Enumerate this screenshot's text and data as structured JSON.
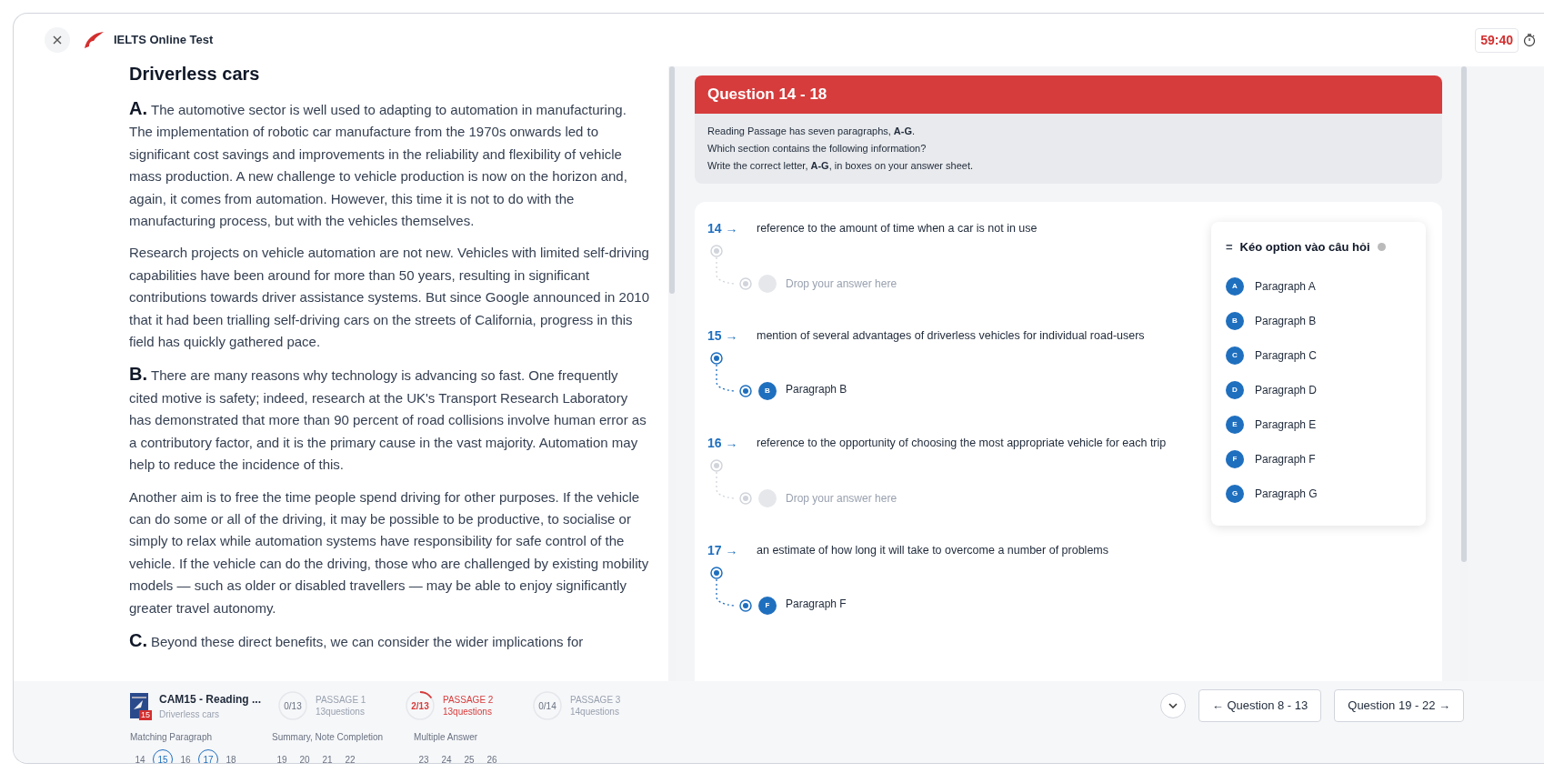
{
  "top_bar": {
    "title": "IELTS Online Test",
    "timer": "59:40"
  },
  "passage": {
    "title": "Driverless cars",
    "paragraphs": [
      {
        "letter": "A.",
        "text": "The automotive sector is well used to adapting to automation in manufacturing. The implementation of robotic car manufacture from the 1970s onwards led to significant cost savings and improvements in the reliability and flexibility of vehicle mass production. A new challenge to vehicle production is now on the horizon and, again, it comes from automation. However, this time it is not to do with the manufacturing process, but with the vehicles themselves."
      },
      {
        "text": "Research projects on vehicle automation are not new. Vehicles with limited self-driving capabilities have been around for more than 50 years, resulting in significant contributions towards driver assistance systems. But since Google announced in 2010 that it had been trialling self-driving cars on the streets of California, progress in this field has quickly gathered pace."
      },
      {
        "letter": "B.",
        "text": "There are many reasons why technology is advancing so fast. One frequently cited motive is safety; indeed, research at the UK's Transport Research Laboratory has demonstrated that more than 90 percent of road collisions involve human error as a contributory factor, and it is the primary cause in the vast majority. Automation may help to reduce the incidence of this."
      },
      {
        "text": "Another aim is to free the time people spend driving for other purposes. If the vehicle can do some or all of the driving, it may be possible to be productive, to socialise or simply to relax while automation systems have responsibility for safe control of the vehicle. If the vehicle can do the driving, those who are challenged by existing mobility models — such as older or disabled travellers — may be able to enjoy significantly greater travel autonomy."
      },
      {
        "letter": "C.",
        "text": "Beyond these direct benefits, we can consider the wider implications for"
      }
    ]
  },
  "question_panel": {
    "title": "Question 14 - 18",
    "instructions": [
      "Reading Passage has seven paragraphs, **A-G**.",
      "Which section contains the following information?",
      "Write the correct letter, **A-G**, in boxes on your answer sheet."
    ]
  },
  "questions": [
    {
      "number": "14",
      "arrow": "→",
      "text": "reference to the amount of time when a car is not in use",
      "placeholder": "Drop your answer here"
    },
    {
      "number": "15",
      "arrow": "→",
      "text": "mention of several advantages of driverless vehicles for individual road-users",
      "answer": {
        "letter": "B",
        "label": "Paragraph B"
      }
    },
    {
      "number": "16",
      "arrow": "→",
      "text": "reference to the opportunity of choosing the most appropriate vehicle for each trip",
      "placeholder": "Drop your answer here"
    },
    {
      "number": "17",
      "arrow": "→",
      "text": "an estimate of how long it will take to overcome a number of problems",
      "answer": {
        "letter": "F",
        "label": "Paragraph F"
      }
    }
  ],
  "options": {
    "handle": "=",
    "title": "Kéo option vào câu hỏi",
    "items": [
      {
        "letter": "A",
        "label": "Paragraph A"
      },
      {
        "letter": "B",
        "label": "Paragraph B"
      },
      {
        "letter": "C",
        "label": "Paragraph C"
      },
      {
        "letter": "D",
        "label": "Paragraph D"
      },
      {
        "letter": "E",
        "label": "Paragraph E"
      },
      {
        "letter": "F",
        "label": "Paragraph F"
      },
      {
        "letter": "G",
        "label": "Paragraph G"
      }
    ]
  },
  "footer": {
    "book": {
      "title": "CAM15 - Reading ...",
      "subtitle": "Driverless cars",
      "badge": "15"
    },
    "passages": [
      {
        "progress": "0/13",
        "title": "PASSAGE 1",
        "count": "13questions",
        "selected": false,
        "level": 0
      },
      {
        "progress": "2/13",
        "title": "PASSAGE 2",
        "count": "13questions",
        "selected": true,
        "level": 0.154
      },
      {
        "progress": "0/14",
        "title": "PASSAGE 3",
        "count": "14questions",
        "selected": false,
        "level": 0
      }
    ],
    "prev": "← Question 8 - 13",
    "next": "Question 19 - 22 →",
    "groups": [
      {
        "title": "Matching Paragraph",
        "numbers": [
          {
            "n": "14",
            "answered": false
          },
          {
            "n": "15",
            "answered": true
          },
          {
            "n": "16",
            "answered": false
          },
          {
            "n": "17",
            "answered": true
          },
          {
            "n": "18",
            "answered": false
          }
        ]
      },
      {
        "title": "Summary, Note Completion",
        "numbers": [
          {
            "n": "19",
            "answered": false
          },
          {
            "n": "20",
            "answered": false
          },
          {
            "n": "21",
            "answered": false
          },
          {
            "n": "22",
            "answered": false
          }
        ]
      },
      {
        "title": "Multiple Answer",
        "numbers": [
          {
            "n": "23",
            "answered": false
          },
          {
            "n": "24",
            "answered": false
          },
          {
            "n": "25",
            "answered": false
          },
          {
            "n": "26",
            "answered": false
          }
        ]
      }
    ]
  }
}
